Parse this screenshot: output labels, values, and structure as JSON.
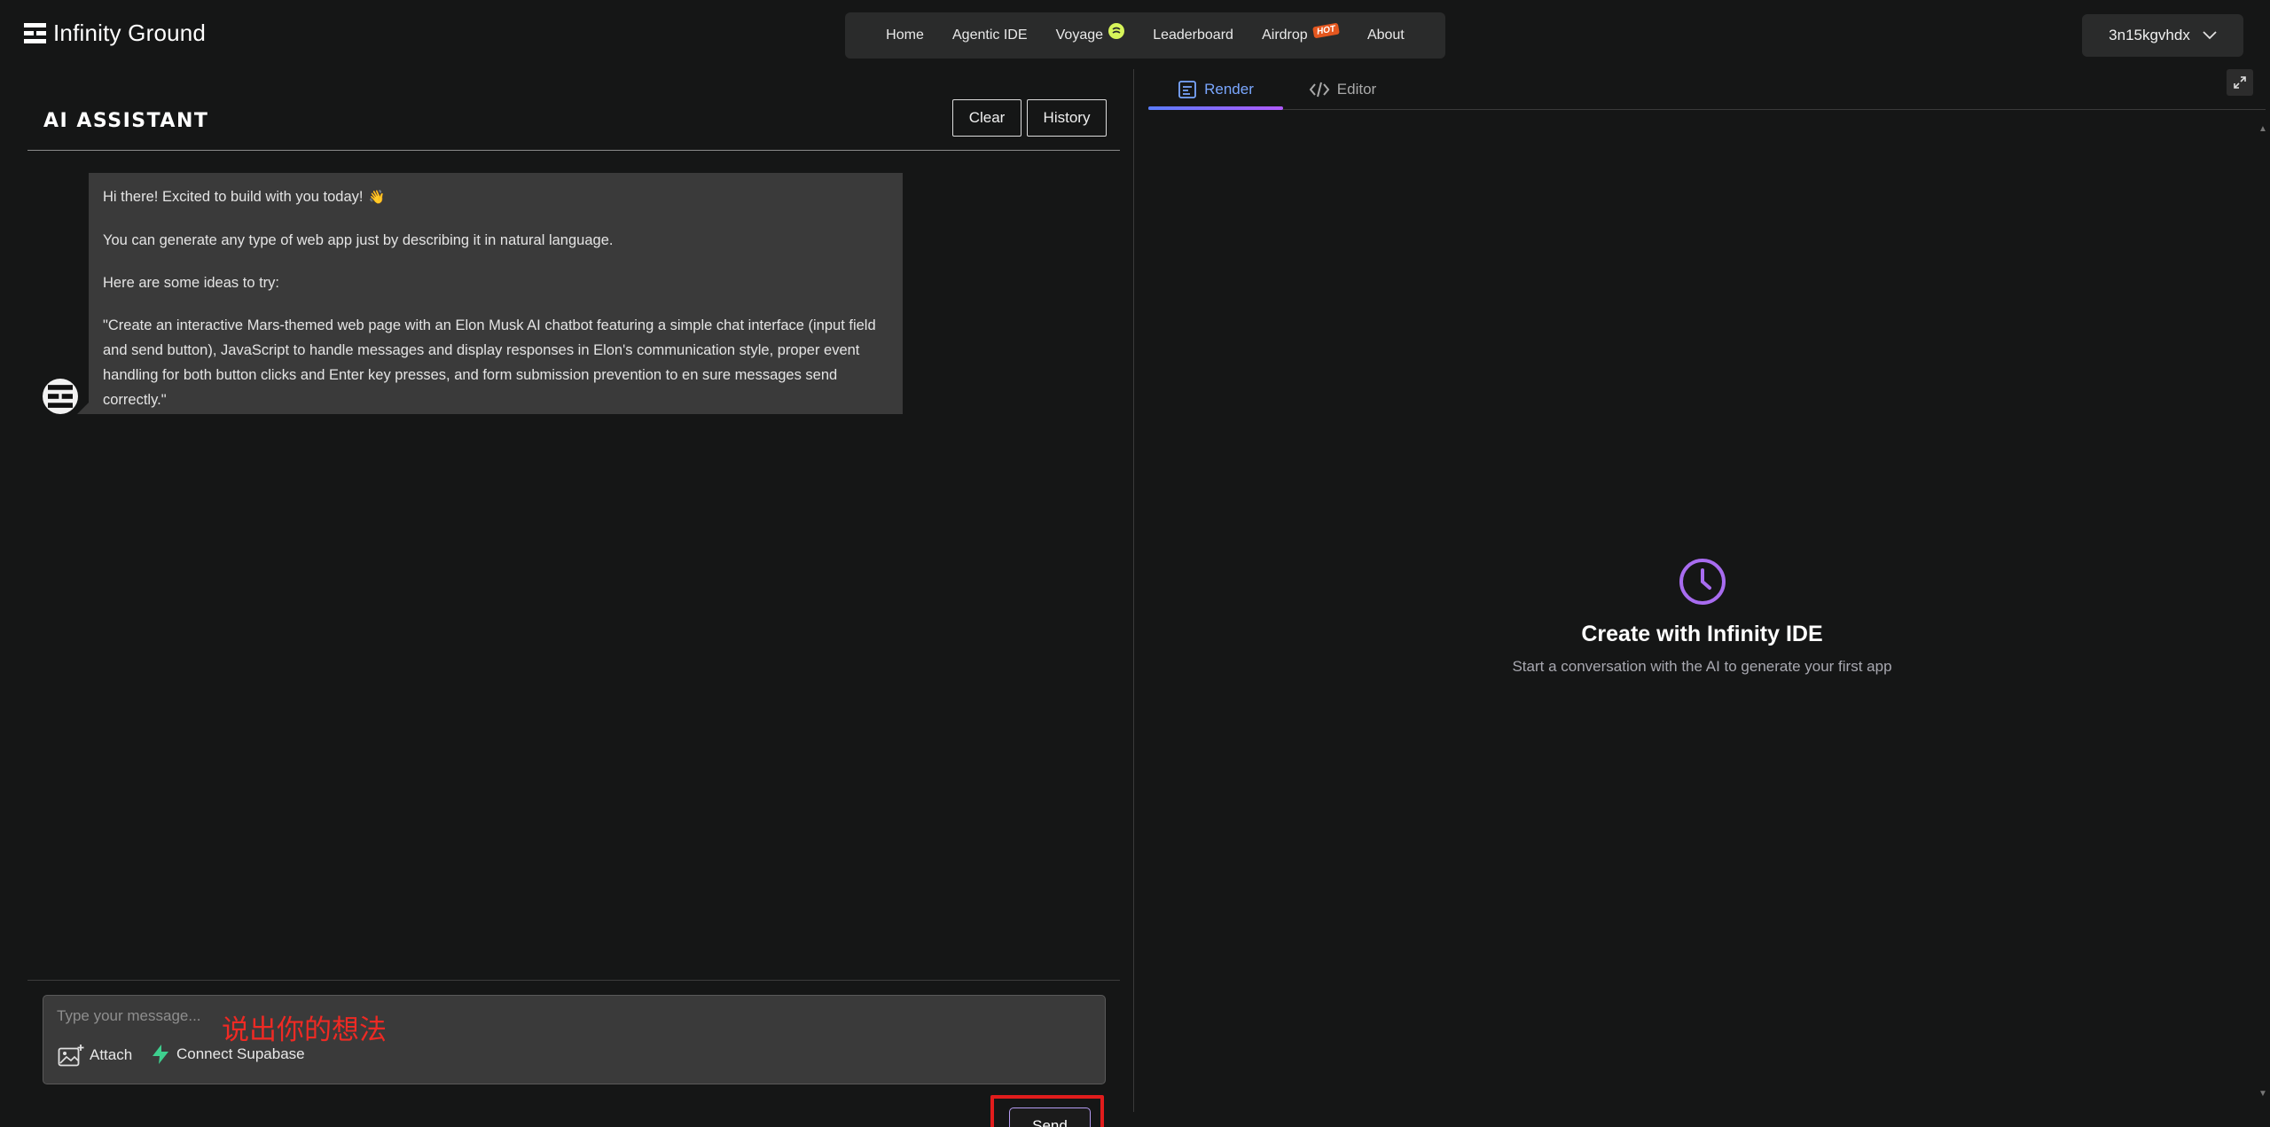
{
  "brand": {
    "name": "Infinity Ground"
  },
  "nav": {
    "items": [
      {
        "label": "Home"
      },
      {
        "label": "Agentic IDE"
      },
      {
        "label": "Voyage"
      },
      {
        "label": "Leaderboard"
      },
      {
        "label": "Airdrop",
        "badge": "HOT"
      },
      {
        "label": "About"
      }
    ]
  },
  "user": {
    "name": "3n15kgvhdx"
  },
  "assistant": {
    "title": "AI ASSISTANT",
    "clear_label": "Clear",
    "history_label": "History"
  },
  "message": {
    "greeting": "Hi there! Excited to build with you today!",
    "greeting_emoji": "👋",
    "intro": "You can generate any type of web app just by describing it in natural language.",
    "ideas_heading": "Here are some ideas to try:",
    "example": "\"Create an interactive Mars-themed web page with an Elon Musk AI chatbot featuring a simple chat interface (input field and send button), JavaScript to handle messages and display responses in Elon's communication style, proper event handling for both button clicks and Enter key presses, and form submission prevention to en sure messages send correctly.\""
  },
  "composer": {
    "placeholder": "Type your message...",
    "annotation": "说出你的想法",
    "attach_label": "Attach",
    "supabase_label": "Connect Supabase",
    "send_label": "Send"
  },
  "preview": {
    "tabs": [
      {
        "label": "Render",
        "active": true
      },
      {
        "label": "Editor",
        "active": false
      }
    ],
    "empty_title": "Create with Infinity IDE",
    "empty_subtitle": "Start a conversation with the AI to generate your first app"
  },
  "colors": {
    "background": "#151616",
    "accent_purple": "#a86cf0",
    "tab_active": "#7aa7ff",
    "annotation_red": "#e11c1c",
    "supabase_green": "#3ecf8e"
  },
  "icons": [
    "brand-logo-icon",
    "chevron-down-icon",
    "render-icon",
    "code-icon",
    "expand-icon",
    "image-plus-icon",
    "supabase-bolt-icon",
    "clock-icon"
  ]
}
